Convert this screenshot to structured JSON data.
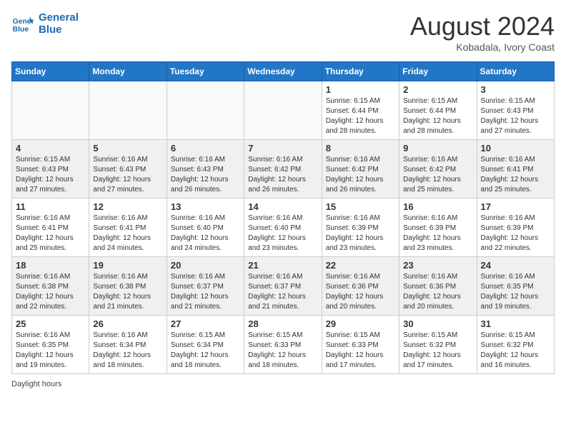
{
  "header": {
    "logo_line1": "General",
    "logo_line2": "Blue",
    "month": "August 2024",
    "location": "Kobadala, Ivory Coast"
  },
  "days_of_week": [
    "Sunday",
    "Monday",
    "Tuesday",
    "Wednesday",
    "Thursday",
    "Friday",
    "Saturday"
  ],
  "weeks": [
    [
      {
        "day": "",
        "info": "",
        "empty": true
      },
      {
        "day": "",
        "info": "",
        "empty": true
      },
      {
        "day": "",
        "info": "",
        "empty": true
      },
      {
        "day": "",
        "info": "",
        "empty": true
      },
      {
        "day": "1",
        "info": "Sunrise: 6:15 AM\nSunset: 6:44 PM\nDaylight: 12 hours and 28 minutes.",
        "empty": false
      },
      {
        "day": "2",
        "info": "Sunrise: 6:15 AM\nSunset: 6:44 PM\nDaylight: 12 hours and 28 minutes.",
        "empty": false
      },
      {
        "day": "3",
        "info": "Sunrise: 6:15 AM\nSunset: 6:43 PM\nDaylight: 12 hours and 27 minutes.",
        "empty": false
      }
    ],
    [
      {
        "day": "4",
        "info": "Sunrise: 6:15 AM\nSunset: 6:43 PM\nDaylight: 12 hours and 27 minutes.",
        "empty": false
      },
      {
        "day": "5",
        "info": "Sunrise: 6:16 AM\nSunset: 6:43 PM\nDaylight: 12 hours and 27 minutes.",
        "empty": false
      },
      {
        "day": "6",
        "info": "Sunrise: 6:16 AM\nSunset: 6:43 PM\nDaylight: 12 hours and 26 minutes.",
        "empty": false
      },
      {
        "day": "7",
        "info": "Sunrise: 6:16 AM\nSunset: 6:42 PM\nDaylight: 12 hours and 26 minutes.",
        "empty": false
      },
      {
        "day": "8",
        "info": "Sunrise: 6:16 AM\nSunset: 6:42 PM\nDaylight: 12 hours and 26 minutes.",
        "empty": false
      },
      {
        "day": "9",
        "info": "Sunrise: 6:16 AM\nSunset: 6:42 PM\nDaylight: 12 hours and 25 minutes.",
        "empty": false
      },
      {
        "day": "10",
        "info": "Sunrise: 6:16 AM\nSunset: 6:41 PM\nDaylight: 12 hours and 25 minutes.",
        "empty": false
      }
    ],
    [
      {
        "day": "11",
        "info": "Sunrise: 6:16 AM\nSunset: 6:41 PM\nDaylight: 12 hours and 25 minutes.",
        "empty": false
      },
      {
        "day": "12",
        "info": "Sunrise: 6:16 AM\nSunset: 6:41 PM\nDaylight: 12 hours and 24 minutes.",
        "empty": false
      },
      {
        "day": "13",
        "info": "Sunrise: 6:16 AM\nSunset: 6:40 PM\nDaylight: 12 hours and 24 minutes.",
        "empty": false
      },
      {
        "day": "14",
        "info": "Sunrise: 6:16 AM\nSunset: 6:40 PM\nDaylight: 12 hours and 23 minutes.",
        "empty": false
      },
      {
        "day": "15",
        "info": "Sunrise: 6:16 AM\nSunset: 6:39 PM\nDaylight: 12 hours and 23 minutes.",
        "empty": false
      },
      {
        "day": "16",
        "info": "Sunrise: 6:16 AM\nSunset: 6:39 PM\nDaylight: 12 hours and 23 minutes.",
        "empty": false
      },
      {
        "day": "17",
        "info": "Sunrise: 6:16 AM\nSunset: 6:39 PM\nDaylight: 12 hours and 22 minutes.",
        "empty": false
      }
    ],
    [
      {
        "day": "18",
        "info": "Sunrise: 6:16 AM\nSunset: 6:38 PM\nDaylight: 12 hours and 22 minutes.",
        "empty": false
      },
      {
        "day": "19",
        "info": "Sunrise: 6:16 AM\nSunset: 6:38 PM\nDaylight: 12 hours and 21 minutes.",
        "empty": false
      },
      {
        "day": "20",
        "info": "Sunrise: 6:16 AM\nSunset: 6:37 PM\nDaylight: 12 hours and 21 minutes.",
        "empty": false
      },
      {
        "day": "21",
        "info": "Sunrise: 6:16 AM\nSunset: 6:37 PM\nDaylight: 12 hours and 21 minutes.",
        "empty": false
      },
      {
        "day": "22",
        "info": "Sunrise: 6:16 AM\nSunset: 6:36 PM\nDaylight: 12 hours and 20 minutes.",
        "empty": false
      },
      {
        "day": "23",
        "info": "Sunrise: 6:16 AM\nSunset: 6:36 PM\nDaylight: 12 hours and 20 minutes.",
        "empty": false
      },
      {
        "day": "24",
        "info": "Sunrise: 6:16 AM\nSunset: 6:35 PM\nDaylight: 12 hours and 19 minutes.",
        "empty": false
      }
    ],
    [
      {
        "day": "25",
        "info": "Sunrise: 6:16 AM\nSunset: 6:35 PM\nDaylight: 12 hours and 19 minutes.",
        "empty": false
      },
      {
        "day": "26",
        "info": "Sunrise: 6:16 AM\nSunset: 6:34 PM\nDaylight: 12 hours and 18 minutes.",
        "empty": false
      },
      {
        "day": "27",
        "info": "Sunrise: 6:15 AM\nSunset: 6:34 PM\nDaylight: 12 hours and 18 minutes.",
        "empty": false
      },
      {
        "day": "28",
        "info": "Sunrise: 6:15 AM\nSunset: 6:33 PM\nDaylight: 12 hours and 18 minutes.",
        "empty": false
      },
      {
        "day": "29",
        "info": "Sunrise: 6:15 AM\nSunset: 6:33 PM\nDaylight: 12 hours and 17 minutes.",
        "empty": false
      },
      {
        "day": "30",
        "info": "Sunrise: 6:15 AM\nSunset: 6:32 PM\nDaylight: 12 hours and 17 minutes.",
        "empty": false
      },
      {
        "day": "31",
        "info": "Sunrise: 6:15 AM\nSunset: 6:32 PM\nDaylight: 12 hours and 16 minutes.",
        "empty": false
      }
    ]
  ],
  "footer": "Daylight hours"
}
